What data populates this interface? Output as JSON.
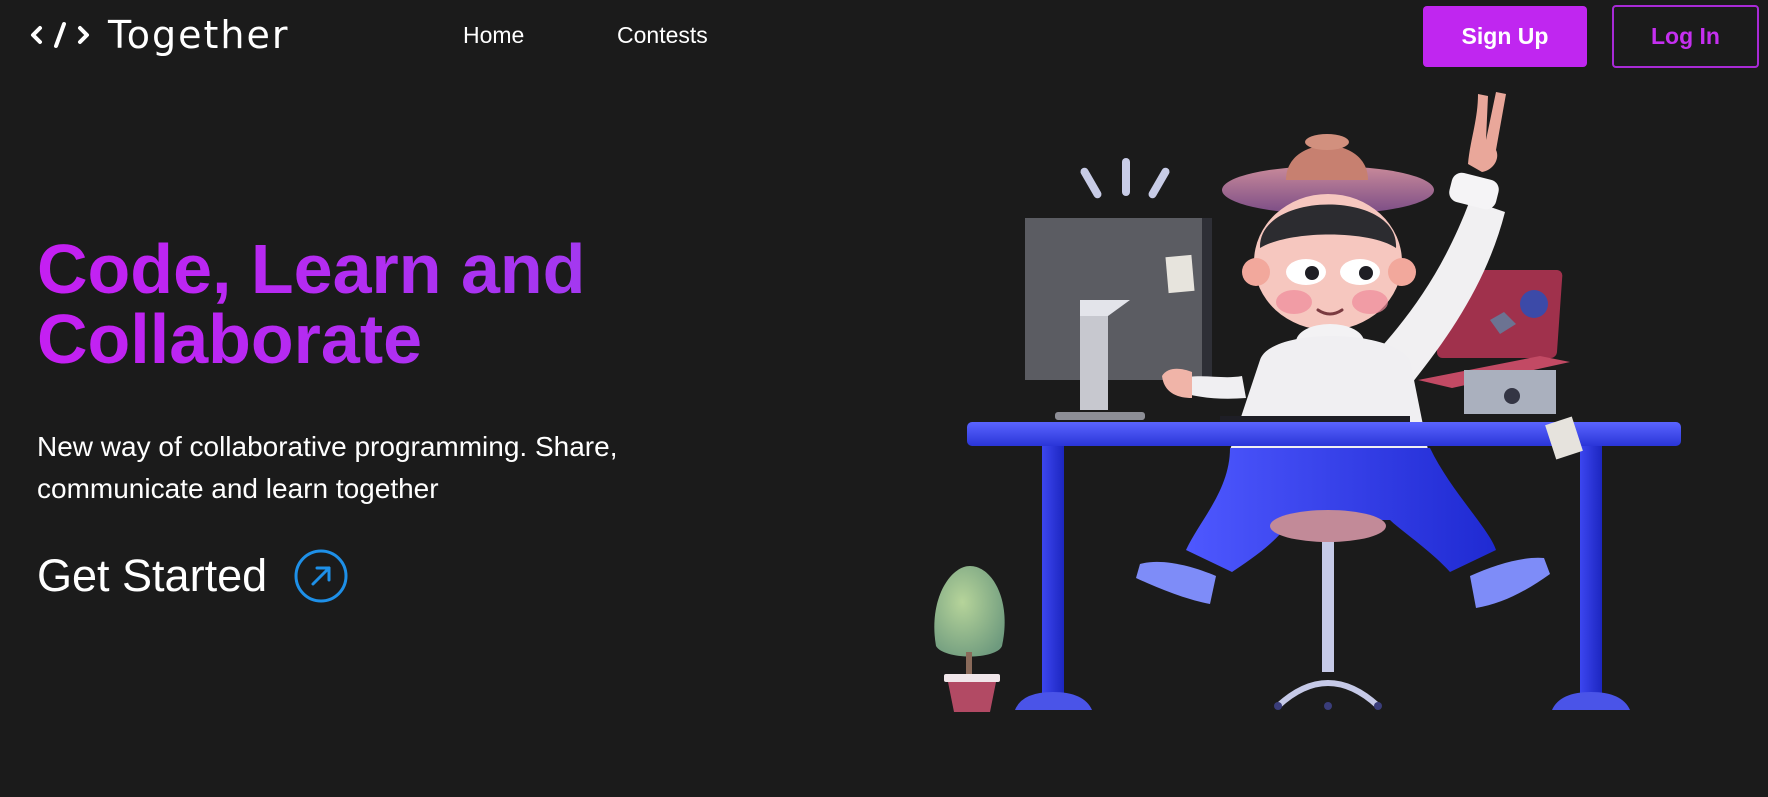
{
  "brand": {
    "logo_icon": "code-brackets-icon",
    "name": "Together"
  },
  "nav": {
    "items": [
      {
        "label": "Home"
      },
      {
        "label": "Contests"
      }
    ]
  },
  "auth": {
    "signup_label": "Sign Up",
    "login_label": "Log In"
  },
  "hero": {
    "title": "Code, Learn and Collaborate",
    "subtitle": "New way of collaborative programming. Share, communicate and learn together",
    "cta_label": "Get Started",
    "cta_icon": "arrow-up-right-circle-icon"
  },
  "colors": {
    "background": "#1b1b1b",
    "accent": "#c026f0",
    "gradient_start": "#c51ff2",
    "gradient_end": "#9a3ff0",
    "cta_icon": "#1e90e8"
  },
  "illustration": {
    "name": "developer-at-desk-illustration"
  }
}
